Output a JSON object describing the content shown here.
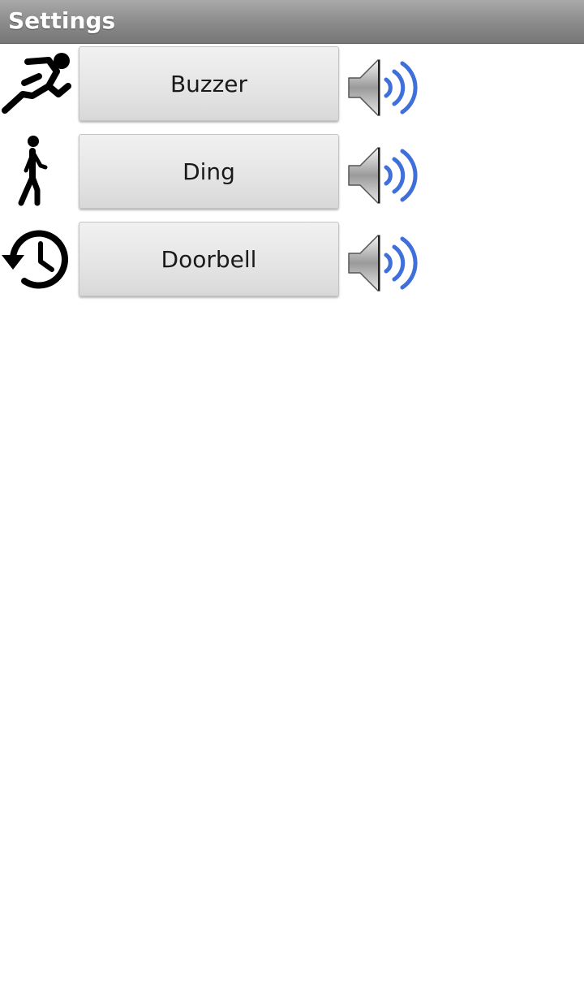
{
  "header": {
    "title": "Settings"
  },
  "rows": [
    {
      "label": "Buzzer",
      "icon": "running-person-icon"
    },
    {
      "label": "Ding",
      "icon": "walking-person-icon"
    },
    {
      "label": "Doorbell",
      "icon": "history-icon"
    }
  ],
  "play_icon": "speaker-volume-icon",
  "colors": {
    "header_top": "#a9a9a9",
    "header_bottom": "#767676",
    "sound_waves": "#3f6fd8",
    "button_face": "#e4e4e4"
  }
}
